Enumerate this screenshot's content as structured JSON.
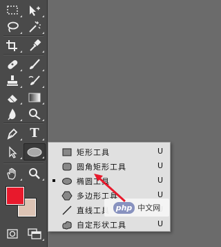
{
  "toolbar": {
    "tools": [
      {
        "name": "marquee-tool",
        "icon": "dashed-rect-icon"
      },
      {
        "name": "move-tool",
        "icon": "move-arrow-icon"
      },
      {
        "name": "lasso-tool",
        "icon": "lasso-icon"
      },
      {
        "name": "magic-wand-tool",
        "icon": "magic-wand-icon"
      },
      {
        "name": "crop-tool",
        "icon": "crop-icon"
      },
      {
        "name": "eyedropper-tool",
        "icon": "eyedropper-icon"
      },
      {
        "name": "healing-brush-tool",
        "icon": "bandage-icon"
      },
      {
        "name": "brush-tool",
        "icon": "brush-icon"
      },
      {
        "name": "clone-stamp-tool",
        "icon": "stamp-icon"
      },
      {
        "name": "history-brush-tool",
        "icon": "history-brush-icon"
      },
      {
        "name": "eraser-tool",
        "icon": "eraser-icon"
      },
      {
        "name": "gradient-tool",
        "icon": "gradient-icon"
      },
      {
        "name": "blur-tool",
        "icon": "drop-icon"
      },
      {
        "name": "dodge-tool",
        "icon": "dodge-icon"
      },
      {
        "name": "pen-tool",
        "icon": "pen-icon"
      },
      {
        "name": "type-tool",
        "icon": "type-icon"
      },
      {
        "name": "path-selection-tool",
        "icon": "arrow-cursor-icon"
      },
      {
        "name": "ellipse-tool",
        "icon": "ellipse-icon"
      },
      {
        "name": "hand-tool",
        "icon": "hand-icon"
      },
      {
        "name": "zoom-tool",
        "icon": "magnifier-icon"
      },
      {
        "name": "quick-mask-mode",
        "icon": "quick-mask-icon"
      },
      {
        "name": "screen-mode",
        "icon": "screen-mode-icon"
      }
    ],
    "type_tool_glyph": "T",
    "colors": {
      "foreground": "#e8192c",
      "background": "#dcc3b4"
    }
  },
  "flyout": {
    "items": [
      {
        "icon": "rectangle-icon",
        "label": "矩形工具",
        "key": "U",
        "selected": false
      },
      {
        "icon": "rounded-rectangle-icon",
        "label": "圆角矩形工具",
        "key": "U",
        "selected": false
      },
      {
        "icon": "ellipse-icon",
        "label": "椭圆工具",
        "key": "U",
        "selected": true
      },
      {
        "icon": "polygon-icon",
        "label": "多边形工具",
        "key": "U",
        "selected": false
      },
      {
        "icon": "line-icon",
        "label": "直线工具",
        "key": "U",
        "selected": false
      },
      {
        "icon": "custom-shape-icon",
        "label": "自定形状工具",
        "key": "U",
        "selected": false
      }
    ]
  },
  "watermark": {
    "logo": "php",
    "text": "中文网"
  }
}
